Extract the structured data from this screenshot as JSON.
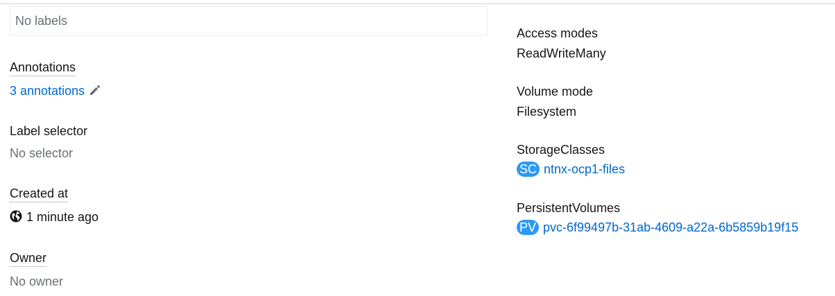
{
  "left": {
    "labels_box": {
      "text": "No labels"
    },
    "annotations": {
      "term": "Annotations",
      "link": "3 annotations",
      "edit_icon": "pencil-icon"
    },
    "label_selector": {
      "term": "Label selector",
      "value": "No selector"
    },
    "created_at": {
      "term": "Created at",
      "value": "1 minute ago",
      "icon": "globe-icon"
    },
    "owner": {
      "term": "Owner",
      "value": "No owner"
    }
  },
  "right": {
    "access_modes": {
      "term": "Access modes",
      "value": "ReadWriteMany"
    },
    "volume_mode": {
      "term": "Volume mode",
      "value": "Filesystem"
    },
    "storage_classes": {
      "term": "StorageClasses",
      "badge": "SC",
      "link": "ntnx-ocp1-files"
    },
    "persistent_volumes": {
      "term": "PersistentVolumes",
      "badge": "PV",
      "link": "pvc-6f99497b-31ab-4609-a22a-6b5859b19f15"
    }
  },
  "colors": {
    "link": "#0066cc",
    "badge_bg": "#2b9af3",
    "muted_text": "#6a6e73",
    "text": "#151515"
  }
}
